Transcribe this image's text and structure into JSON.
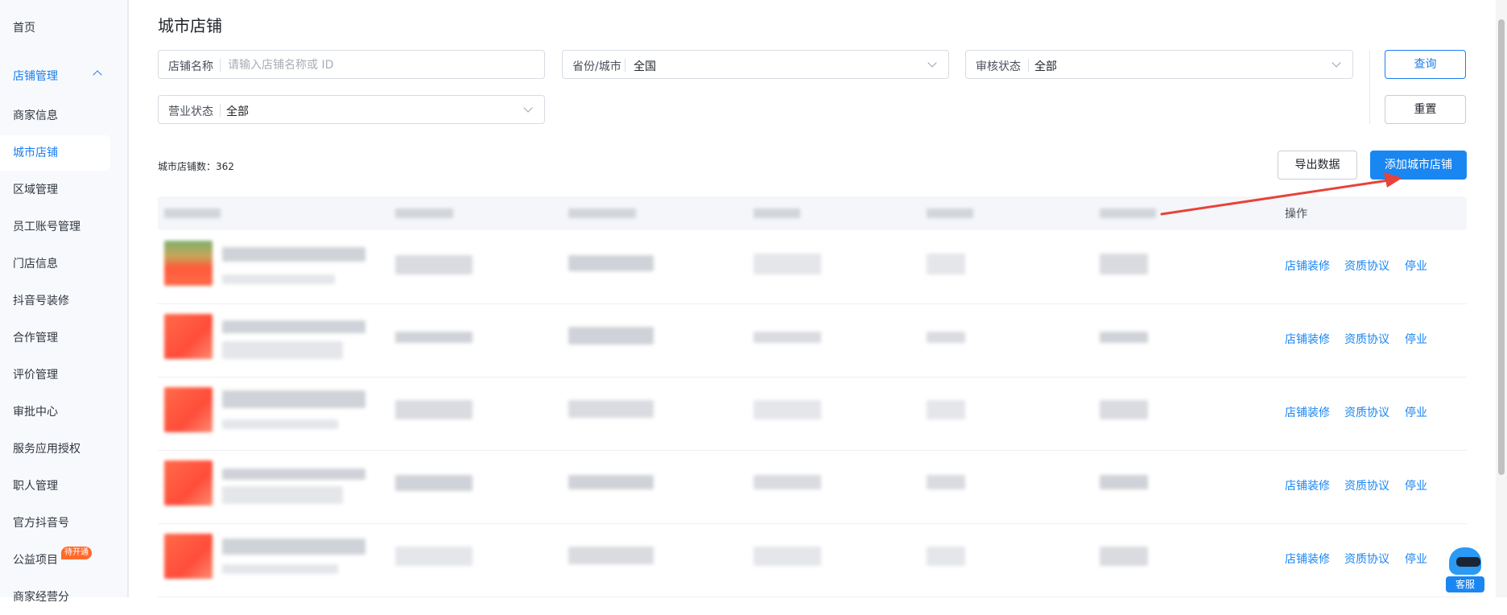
{
  "sidebar": {
    "items": [
      {
        "label": "首页"
      },
      {
        "label": "店铺管理"
      },
      {
        "label": "商家信息"
      },
      {
        "label": "城市店铺"
      },
      {
        "label": "区域管理"
      },
      {
        "label": "员工账号管理"
      },
      {
        "label": "门店信息"
      },
      {
        "label": "抖音号装修"
      },
      {
        "label": "合作管理"
      },
      {
        "label": "评价管理"
      },
      {
        "label": "审批中心"
      },
      {
        "label": "服务应用授权"
      },
      {
        "label": "职人管理"
      },
      {
        "label": "官方抖音号"
      },
      {
        "label": "公益项目",
        "badge": "待开通"
      },
      {
        "label": "商家经营分"
      }
    ],
    "active": "城市店铺"
  },
  "page": {
    "title": "城市店铺"
  },
  "filters": {
    "store_name": {
      "label": "店铺名称",
      "placeholder": "请输入店铺名称或 ID"
    },
    "province_city": {
      "label": "省份/城市",
      "value": "全国"
    },
    "audit_status": {
      "label": "审核状态",
      "value": "全部"
    },
    "business_status": {
      "label": "营业状态",
      "value": "全部"
    }
  },
  "buttons": {
    "query": "查询",
    "reset": "重置",
    "export": "导出数据",
    "add": "添加城市店铺"
  },
  "summary": {
    "count_label": "城市店铺数：362"
  },
  "table": {
    "op_header": "操作",
    "rows": [
      {
        "actions": [
          "店铺装修",
          "资质协议",
          "停业"
        ]
      },
      {
        "actions": [
          "店铺装修",
          "资质协议",
          "停业"
        ]
      },
      {
        "actions": [
          "店铺装修",
          "资质协议",
          "停业"
        ]
      },
      {
        "actions": [
          "店铺装修",
          "资质协议",
          "停业"
        ]
      },
      {
        "actions": [
          "店铺装修",
          "资质协议",
          "停业"
        ]
      }
    ]
  },
  "service": {
    "label": "客服"
  },
  "colors": {
    "primary": "#1a86f2",
    "arrow": "#e8423a",
    "badge": "#ff6a2b"
  }
}
